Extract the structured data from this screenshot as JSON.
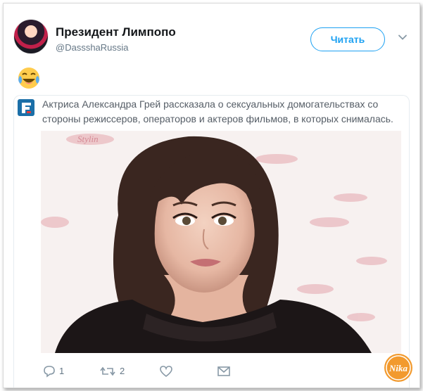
{
  "tweet": {
    "user_name": "Президент Лимпопо",
    "handle": "@DassshaRussia",
    "follow_label": "Читать",
    "emoji": "face-with-tears-of-joy"
  },
  "quote": {
    "text": "Актриса Александра Грей рассказала о сексуальных домогательствах со стороны режиссеров, операторов и актеров фильмов, в которых снималась.",
    "image": "actress-photo",
    "backdrop_text": "Stylin"
  },
  "actions": {
    "reply_count": "1",
    "retweet_count": "2"
  },
  "watermark": "Nika",
  "colors": {
    "accent": "#1da1f2",
    "text_primary": "#14171a",
    "text_secondary": "#657786",
    "border": "#e6ecf0",
    "watermark_orange": "#f29a2e"
  }
}
